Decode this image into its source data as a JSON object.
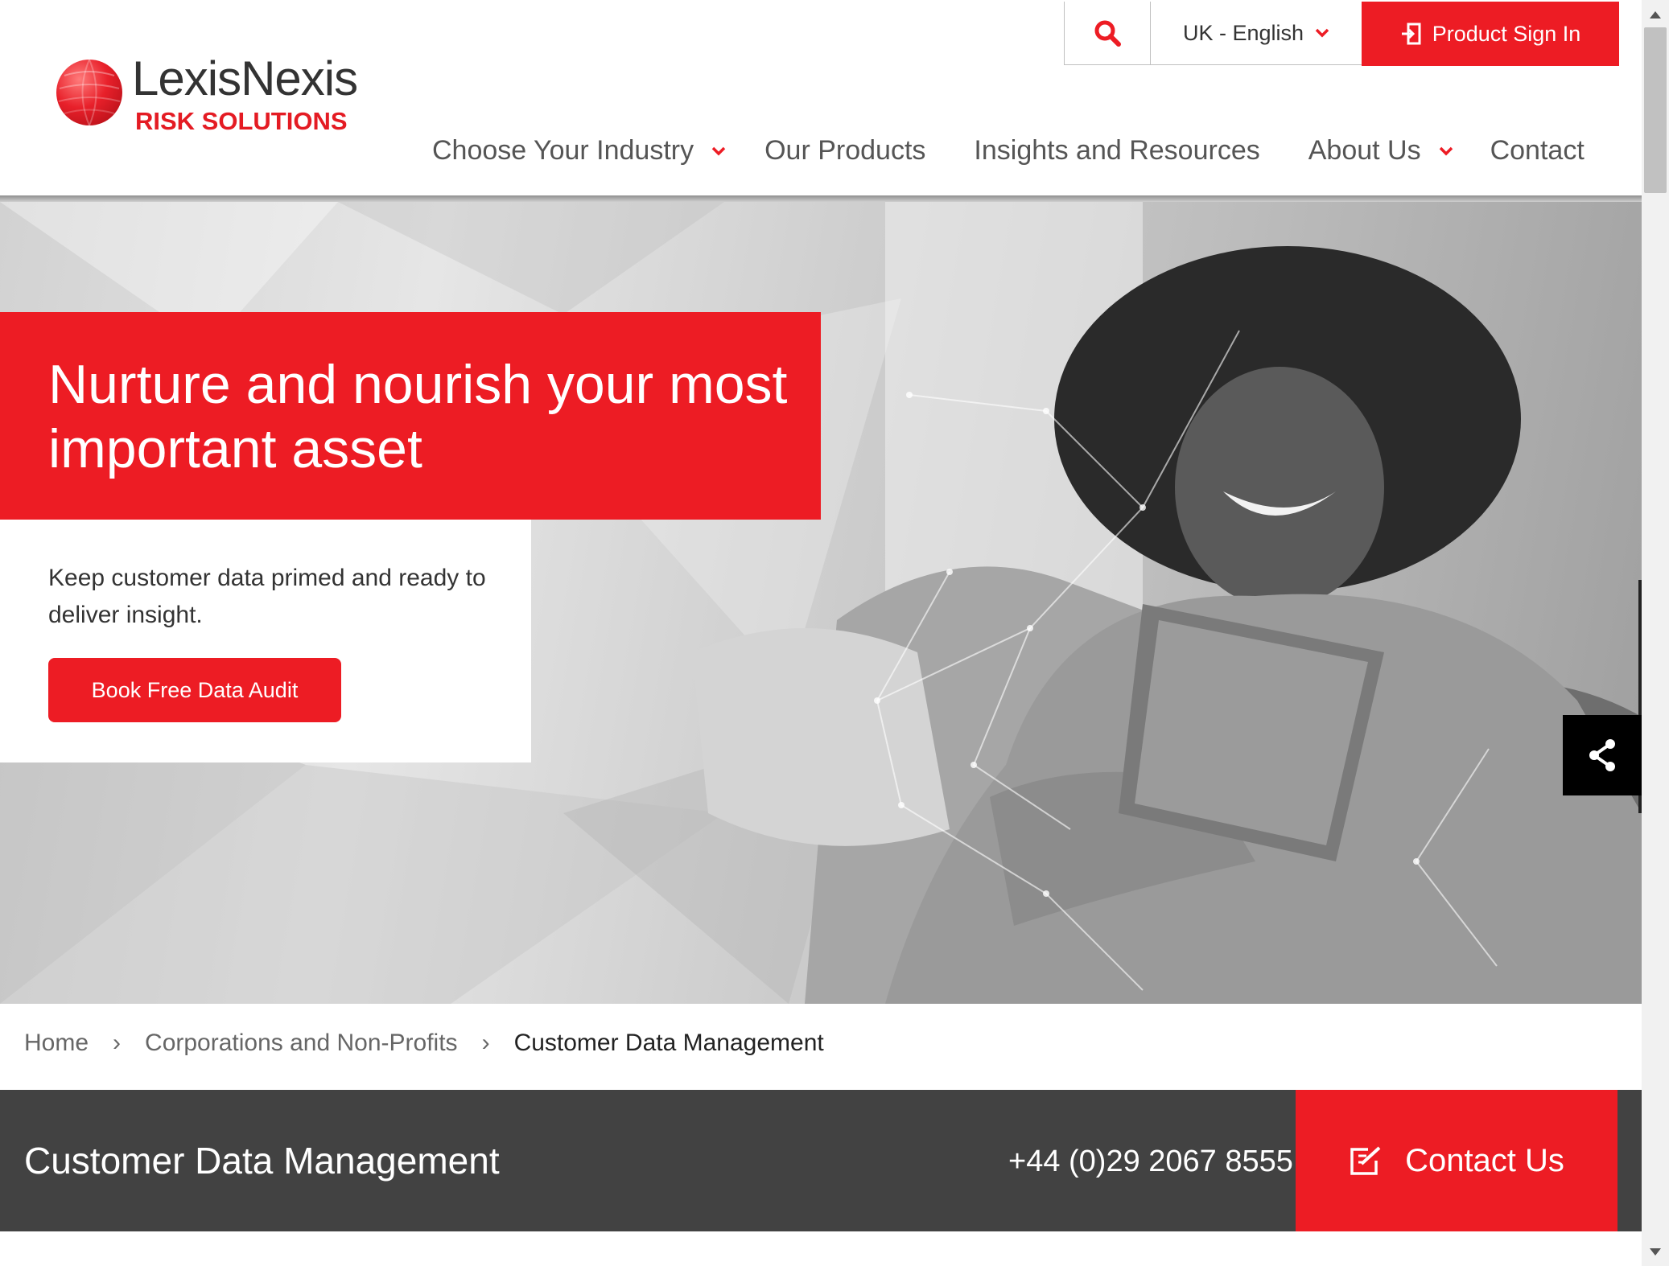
{
  "brand": {
    "name": "LexisNexis",
    "tagline": "RISK SOLUTIONS",
    "accent_color": "#ed1c24"
  },
  "utility": {
    "search_icon": "search-icon",
    "language": "UK - English",
    "sign_in": "Product Sign In"
  },
  "nav": {
    "items": [
      {
        "label": "Choose Your Industry",
        "has_dropdown": true
      },
      {
        "label": "Our Products",
        "has_dropdown": false
      },
      {
        "label": "Insights and Resources",
        "has_dropdown": false
      },
      {
        "label": "About Us",
        "has_dropdown": true
      },
      {
        "label": "Contact",
        "has_dropdown": false
      }
    ]
  },
  "hero": {
    "title": "Nurture and nourish your most important asset",
    "subtitle": "Keep customer data primed and ready to deliver insight.",
    "cta": "Book Free Data Audit",
    "share_icon": "share-icon"
  },
  "breadcrumb": {
    "items": [
      "Home",
      "Corporations and Non-Profits"
    ],
    "separator": "›",
    "current": "Customer Data Management"
  },
  "title_bar": {
    "title": "Customer Data Management",
    "phone": "+44 (0)29 2067 8555",
    "contact": "Contact Us",
    "contact_icon": "edit-icon"
  }
}
